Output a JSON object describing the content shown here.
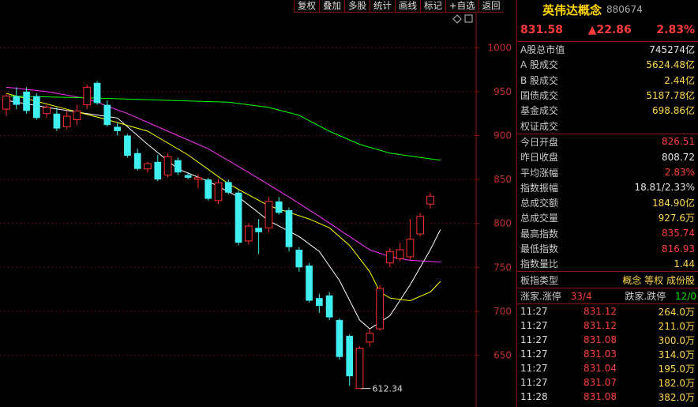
{
  "toolbar": {
    "buttons": [
      "复权",
      "叠加",
      "多股",
      "统计",
      "画线",
      "标记",
      "+自选",
      "返回"
    ]
  },
  "chart": {
    "y_ticks": [
      "1000",
      "950",
      "900",
      "850",
      "800",
      "750",
      "700",
      "650"
    ],
    "low_label": "612.34",
    "icons": [
      "diamond-icon",
      "box-icon"
    ]
  },
  "chart_data": {
    "type": "candlestick",
    "ylim": [
      600,
      1030
    ],
    "y_ticks": [
      1000,
      950,
      900,
      850,
      800,
      750,
      700,
      650
    ],
    "candles": [
      {
        "o": 930,
        "h": 948,
        "l": 922,
        "c": 945
      },
      {
        "o": 945,
        "h": 955,
        "l": 930,
        "c": 935
      },
      {
        "o": 950,
        "h": 955,
        "l": 925,
        "c": 928
      },
      {
        "o": 945,
        "h": 948,
        "l": 918,
        "c": 920
      },
      {
        "o": 925,
        "h": 935,
        "l": 920,
        "c": 932
      },
      {
        "o": 925,
        "h": 932,
        "l": 905,
        "c": 908
      },
      {
        "o": 910,
        "h": 928,
        "l": 907,
        "c": 922
      },
      {
        "o": 918,
        "h": 935,
        "l": 912,
        "c": 928
      },
      {
        "o": 935,
        "h": 958,
        "l": 930,
        "c": 955
      },
      {
        "o": 960,
        "h": 962,
        "l": 935,
        "c": 937
      },
      {
        "o": 935,
        "h": 940,
        "l": 910,
        "c": 912
      },
      {
        "o": 910,
        "h": 915,
        "l": 900,
        "c": 905
      },
      {
        "o": 900,
        "h": 902,
        "l": 875,
        "c": 877
      },
      {
        "o": 880,
        "h": 885,
        "l": 860,
        "c": 862
      },
      {
        "o": 862,
        "h": 870,
        "l": 858,
        "c": 868
      },
      {
        "o": 870,
        "h": 878,
        "l": 848,
        "c": 850
      },
      {
        "o": 855,
        "h": 880,
        "l": 852,
        "c": 876
      },
      {
        "o": 872,
        "h": 875,
        "l": 855,
        "c": 858
      },
      {
        "o": 855,
        "h": 858,
        "l": 850,
        "c": 852
      },
      {
        "o": 850,
        "h": 856,
        "l": 840,
        "c": 852
      },
      {
        "o": 850,
        "h": 852,
        "l": 826,
        "c": 828
      },
      {
        "o": 826,
        "h": 850,
        "l": 822,
        "c": 846
      },
      {
        "o": 847,
        "h": 850,
        "l": 833,
        "c": 835
      },
      {
        "o": 835,
        "h": 838,
        "l": 775,
        "c": 778
      },
      {
        "o": 780,
        "h": 800,
        "l": 776,
        "c": 797
      },
      {
        "o": 795,
        "h": 805,
        "l": 765,
        "c": 790
      },
      {
        "o": 795,
        "h": 830,
        "l": 790,
        "c": 825
      },
      {
        "o": 825,
        "h": 830,
        "l": 810,
        "c": 812
      },
      {
        "o": 815,
        "h": 818,
        "l": 768,
        "c": 773
      },
      {
        "o": 770,
        "h": 773,
        "l": 745,
        "c": 750
      },
      {
        "o": 752,
        "h": 755,
        "l": 710,
        "c": 712
      },
      {
        "o": 715,
        "h": 720,
        "l": 698,
        "c": 706
      },
      {
        "o": 718,
        "h": 722,
        "l": 690,
        "c": 693
      },
      {
        "o": 690,
        "h": 692,
        "l": 645,
        "c": 648
      },
      {
        "o": 672,
        "h": 674,
        "l": 615,
        "c": 626
      },
      {
        "o": 612,
        "h": 660,
        "l": 612,
        "c": 658
      },
      {
        "o": 665,
        "h": 680,
        "l": 660,
        "c": 675
      },
      {
        "o": 680,
        "h": 730,
        "l": 678,
        "c": 726
      },
      {
        "o": 755,
        "h": 772,
        "l": 750,
        "c": 768
      },
      {
        "o": 760,
        "h": 778,
        "l": 757,
        "c": 770
      },
      {
        "o": 762,
        "h": 805,
        "l": 758,
        "c": 782
      },
      {
        "o": 788,
        "h": 812,
        "l": 785,
        "c": 808
      },
      {
        "o": 822,
        "h": 835,
        "l": 817,
        "c": 831
      }
    ],
    "ma_series": [
      {
        "color": "#ffffff",
        "points": [
          [
            0,
            940
          ],
          [
            4,
            932
          ],
          [
            8,
            925
          ],
          [
            11,
            920
          ],
          [
            14,
            890
          ],
          [
            17,
            862
          ],
          [
            20,
            848
          ],
          [
            23,
            830
          ],
          [
            26,
            803
          ],
          [
            29,
            785
          ],
          [
            31,
            768
          ],
          [
            33,
            735
          ],
          [
            35,
            690
          ],
          [
            36,
            680
          ],
          [
            38,
            695
          ],
          [
            40,
            730
          ],
          [
            42,
            770
          ],
          [
            43,
            793
          ]
        ]
      },
      {
        "color": "#ffff00",
        "points": [
          [
            0,
            948
          ],
          [
            6,
            930
          ],
          [
            10,
            918
          ],
          [
            14,
            905
          ],
          [
            18,
            878
          ],
          [
            22,
            845
          ],
          [
            26,
            820
          ],
          [
            30,
            805
          ],
          [
            32,
            795
          ],
          [
            34,
            775
          ],
          [
            36,
            745
          ],
          [
            37,
            722
          ],
          [
            38,
            715
          ],
          [
            40,
            712
          ],
          [
            42,
            722
          ],
          [
            43,
            734
          ]
        ]
      },
      {
        "color": "#ff30ff",
        "points": [
          [
            0,
            955
          ],
          [
            4,
            950
          ],
          [
            8,
            942
          ],
          [
            12,
            925
          ],
          [
            16,
            905
          ],
          [
            20,
            885
          ],
          [
            24,
            858
          ],
          [
            28,
            830
          ],
          [
            31,
            808
          ],
          [
            34,
            785
          ],
          [
            36,
            770
          ],
          [
            38,
            762
          ],
          [
            40,
            758
          ],
          [
            43,
            756
          ]
        ]
      },
      {
        "color": "#00ff00",
        "points": [
          [
            0,
            945
          ],
          [
            8,
            943
          ],
          [
            16,
            940
          ],
          [
            22,
            938
          ],
          [
            26,
            932
          ],
          [
            29,
            923
          ],
          [
            32,
            905
          ],
          [
            35,
            890
          ],
          [
            38,
            880
          ],
          [
            41,
            875
          ],
          [
            43,
            872
          ]
        ]
      }
    ]
  },
  "panel": {
    "name": "英伟达概念",
    "code": "880674",
    "price": "831.58",
    "change": "▲22.86",
    "pct": "2.83%",
    "stats": [
      {
        "label": "A股总市值",
        "value": "745274亿",
        "color": "v-wht"
      },
      {
        "label": "A 股成交",
        "value": "5624.48亿",
        "color": "v-yel"
      },
      {
        "label": "B 股成交",
        "value": "2.44亿",
        "color": "v-yel"
      },
      {
        "label": "国债成交",
        "value": "5187.78亿",
        "color": "v-yel"
      },
      {
        "label": "基金成交",
        "value": "698.86亿",
        "color": "v-yel"
      },
      {
        "label": "权证成交",
        "value": "",
        "color": "v-yel"
      },
      {
        "label": "今日开盘",
        "value": "826.51",
        "color": "v-red"
      },
      {
        "label": "昨日收盘",
        "value": "808.72",
        "color": "v-wht"
      },
      {
        "label": "平均涨幅",
        "value": "2.83%",
        "color": "v-red"
      },
      {
        "label": "指数振幅",
        "value": "18.81/2.33%",
        "color": "v-wht"
      },
      {
        "label": "总成交额",
        "value": "184.90亿",
        "color": "v-yel"
      },
      {
        "label": "总成交量",
        "value": "927.6万",
        "color": "v-yel"
      },
      {
        "label": "最高指数",
        "value": "835.74",
        "color": "v-red"
      },
      {
        "label": "最低指数",
        "value": "816.93",
        "color": "v-red"
      },
      {
        "label": "指数量比",
        "value": "1.44",
        "color": "v-yel"
      }
    ],
    "type_label": "板指类型",
    "type_tags": "概念 等权 成份股",
    "zt_label": "涨家.涨停",
    "zt_value": "33/4",
    "dt_label": "跌家.跌停",
    "dt_value": "12/0",
    "ticks": [
      {
        "time": "11:27",
        "price": "831.12",
        "vol": "264.0万"
      },
      {
        "time": "11:27",
        "price": "831.12",
        "vol": "211.0万"
      },
      {
        "time": "11:27",
        "price": "831.08",
        "vol": "300.0万"
      },
      {
        "time": "11:27",
        "price": "831.03",
        "vol": "314.0万"
      },
      {
        "time": "11:27",
        "price": "831.04",
        "vol": "195.0万"
      },
      {
        "time": "11:27",
        "price": "831.07",
        "vol": "182.0万"
      },
      {
        "time": "11:28",
        "price": "831.08",
        "vol": "382.0万"
      }
    ]
  }
}
